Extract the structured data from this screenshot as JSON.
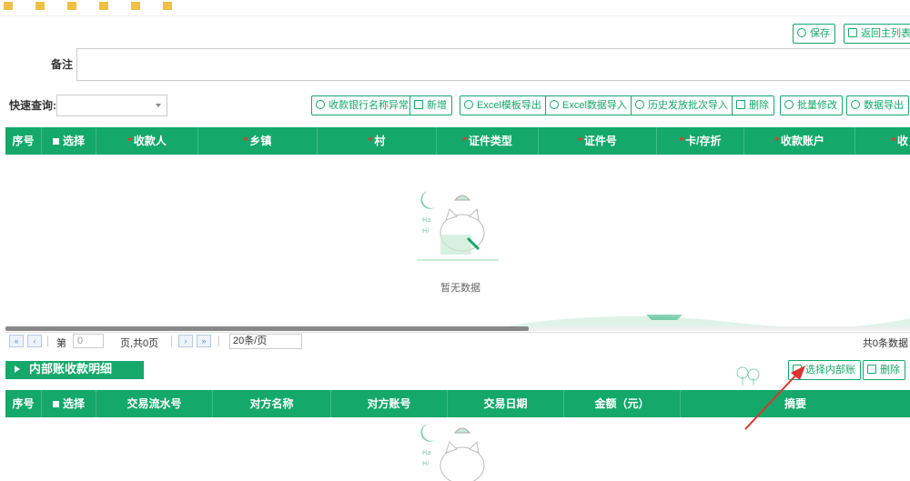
{
  "header_buttons": {
    "save": "保存",
    "back": "返回主列表"
  },
  "remark": {
    "label": "备注",
    "value": ""
  },
  "quick_search": {
    "label": "快速查询:",
    "value": ""
  },
  "toolbar": {
    "bank_anomaly": "收款银行名称异常",
    "add": "新增",
    "excel_template_export": "Excel模板导出",
    "excel_import": "Excel数据导入",
    "history_batch_import": "历史发放批次导入",
    "delete": "删除",
    "batch_modify": "批量修改",
    "data_export": "数据导出"
  },
  "main_table": {
    "columns": [
      "序号",
      "选择",
      "收款人",
      "乡镇",
      "村",
      "证件类型",
      "证件号",
      "卡/存折",
      "收款账户",
      "收"
    ],
    "empty_text": "暂无数据"
  },
  "pager": {
    "page_prefix": "第",
    "page_value": "0",
    "page_suffix": "页,共0页",
    "page_size": "20条/页",
    "total": "共0条数据"
  },
  "internal_section": {
    "title": "内部账收款明细",
    "select_button": "选择内部账",
    "delete_button": "删除",
    "columns": [
      "序号",
      "选择",
      "交易流水号",
      "对方名称",
      "对方账号",
      "交易日期",
      "金额（元）",
      "摘要"
    ]
  },
  "colors": {
    "primary": "#14a86a",
    "arrow": "#e03030"
  }
}
